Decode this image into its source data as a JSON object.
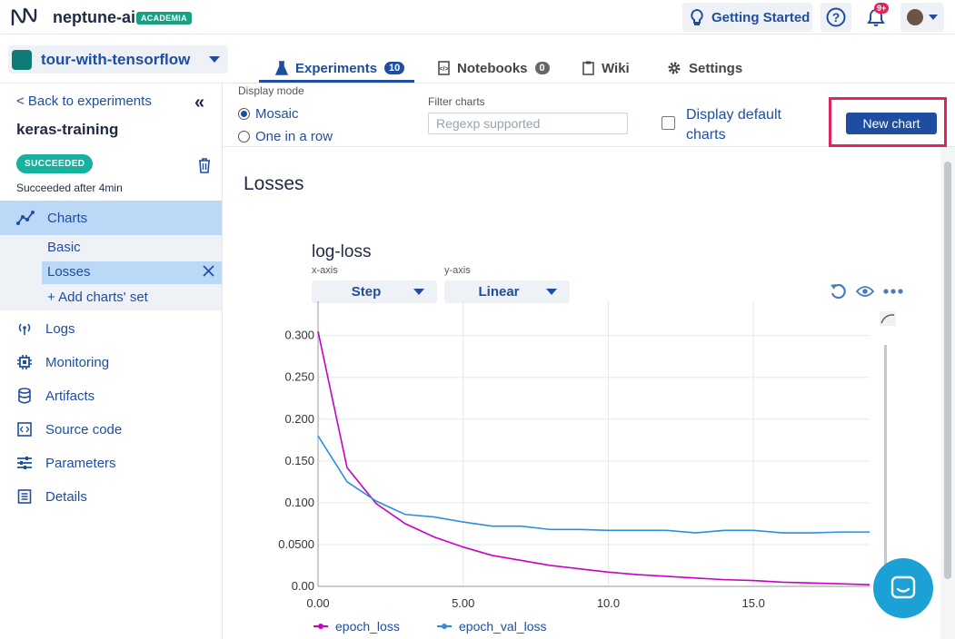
{
  "topbar": {
    "brand": "neptune-ai",
    "plan_badge": "ACADEMIA",
    "getting_started": "Getting Started",
    "notifications_badge": "9+",
    "icons": [
      "neptune-logo-icon",
      "lightbulb-icon",
      "help-icon",
      "bell-icon",
      "avatar",
      "caret-down-icon"
    ]
  },
  "project": {
    "name": "tour-with-tensorflow",
    "color": "#0f7b75"
  },
  "tabs": [
    {
      "label": "Experiments",
      "count": "10",
      "active": true
    },
    {
      "label": "Notebooks",
      "count": "0",
      "active": false
    },
    {
      "label": "Wiki",
      "active": false
    },
    {
      "label": "Settings",
      "active": false
    }
  ],
  "sidebar": {
    "back": "< Back to experiments",
    "experiment": "keras-training",
    "status_badge": "SUCCEEDED",
    "status_text": "Succeeded after 4min",
    "charts": "Charts",
    "sub": [
      "Basic",
      "Losses",
      "+ Add charts' set"
    ],
    "items": [
      "Logs",
      "Monitoring",
      "Artifacts",
      "Source code",
      "Parameters",
      "Details"
    ]
  },
  "toolbar": {
    "display_mode": "Display mode",
    "mosaic": "Mosaic",
    "one_in_row": "One in a row",
    "filter_label": "Filter charts",
    "filter_placeholder": "Regexp supported",
    "display_default": "Display default charts",
    "new_chart": "New chart"
  },
  "section": {
    "title": "Losses"
  },
  "chart_data": {
    "type": "line",
    "title": "log-loss",
    "x_axis_label": "x-axis",
    "y_axis_label": "y-axis",
    "x_axis_value": "Step",
    "y_axis_value": "Linear",
    "xlim": [
      0,
      19
    ],
    "ylim": [
      0,
      0.33
    ],
    "x_ticks": [
      "0.00",
      "5.00",
      "10.0",
      "15.0"
    ],
    "y_ticks": [
      "0.00",
      "0.0500",
      "0.100",
      "0.150",
      "0.200",
      "0.250",
      "0.300"
    ],
    "grid": true,
    "legend_placement": "bottom",
    "series": [
      {
        "name": "epoch_loss",
        "color": "#c800c8",
        "x": [
          0,
          1,
          2,
          3,
          4,
          5,
          6,
          7,
          8,
          9,
          10,
          11,
          12,
          13,
          14,
          15,
          16,
          17,
          18,
          19
        ],
        "values": [
          0.305,
          0.142,
          0.099,
          0.075,
          0.059,
          0.047,
          0.037,
          0.031,
          0.025,
          0.021,
          0.017,
          0.014,
          0.012,
          0.01,
          0.008,
          0.007,
          0.005,
          0.004,
          0.003,
          0.002
        ]
      },
      {
        "name": "epoch_val_loss",
        "color": "#2b8fe0",
        "x": [
          0,
          1,
          2,
          3,
          4,
          5,
          6,
          7,
          8,
          9,
          10,
          11,
          12,
          13,
          14,
          15,
          16,
          17,
          18,
          19
        ],
        "values": [
          0.18,
          0.125,
          0.102,
          0.086,
          0.083,
          0.077,
          0.072,
          0.072,
          0.068,
          0.068,
          0.067,
          0.067,
          0.067,
          0.064,
          0.067,
          0.067,
          0.064,
          0.064,
          0.065,
          0.065
        ]
      }
    ]
  }
}
